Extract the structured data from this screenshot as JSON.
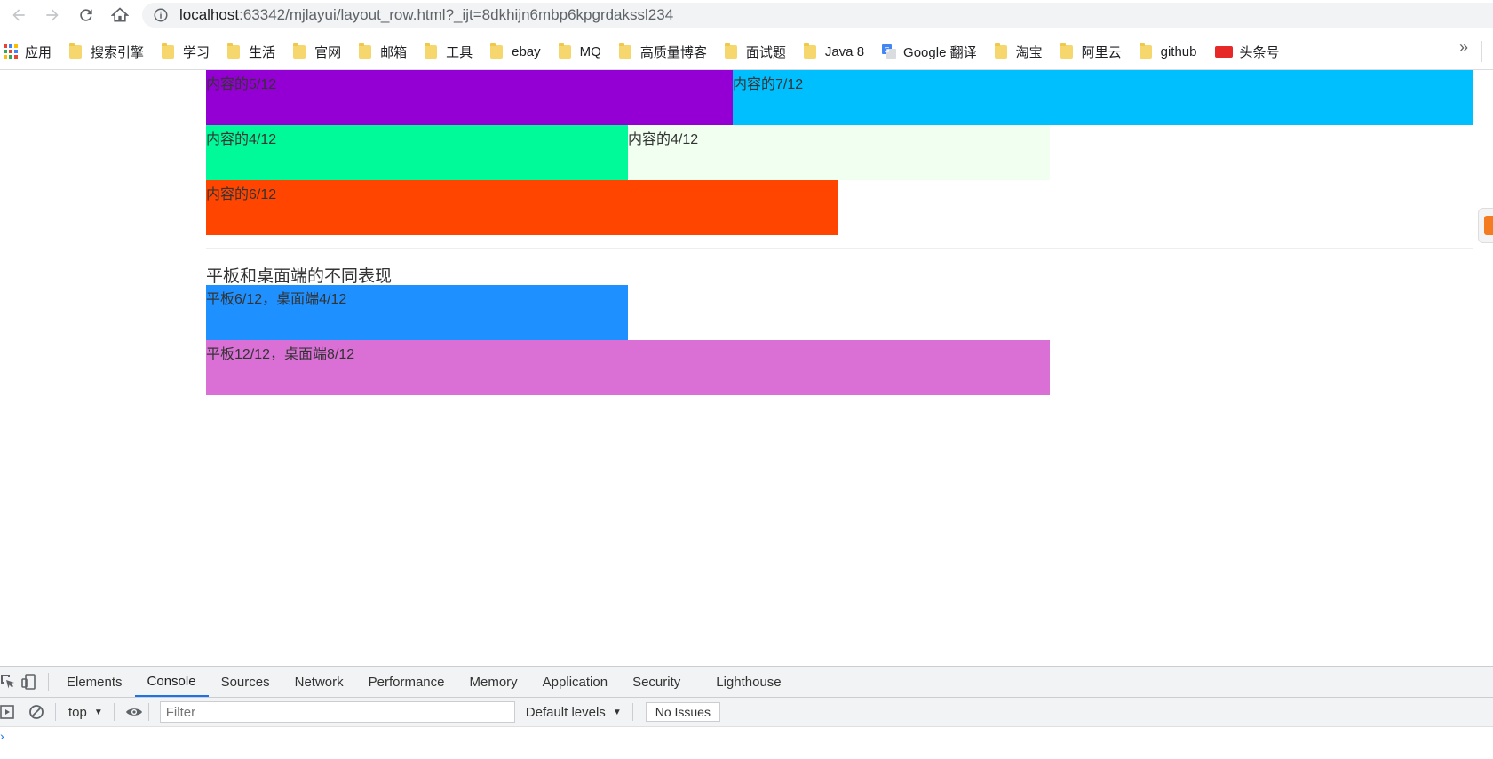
{
  "browser": {
    "url_host": "localhost",
    "url_path": ":63342/mjlayui/layout_row.html?_ijt=8dkhijn6mbp6kpgrdakssl234"
  },
  "bookmarks": {
    "apps_label": "应用",
    "items": [
      {
        "label": "搜索引擎"
      },
      {
        "label": "学习"
      },
      {
        "label": "生活"
      },
      {
        "label": "官网"
      },
      {
        "label": "邮箱"
      },
      {
        "label": "工具"
      },
      {
        "label": "ebay"
      },
      {
        "label": "MQ"
      },
      {
        "label": "高质量博客"
      },
      {
        "label": "面试题"
      },
      {
        "label": "Java 8"
      }
    ],
    "translate_label": "Google 翻译",
    "items2": [
      {
        "label": "淘宝"
      },
      {
        "label": "阿里云"
      },
      {
        "label": "github"
      }
    ],
    "toutiao_label": "头条号",
    "more": "»"
  },
  "page": {
    "rows": [
      [
        {
          "label": "内容的5/12",
          "color": "#9400d3"
        },
        {
          "label": "内容的7/12",
          "color": "#00bfff"
        }
      ],
      [
        {
          "label": "内容的4/12",
          "color": "#00fa9a"
        },
        {
          "label": "内容的4/12",
          "color": "#f0fff0"
        }
      ],
      [
        {
          "label": "内容的6/12",
          "color": "#ff4500"
        }
      ]
    ],
    "section_title": "平板和桌面端的不同表现",
    "responsive_rows": [
      {
        "label": "平板6/12，桌面端4/12",
        "color": "#1e90ff"
      },
      {
        "label": "平板12/12，桌面端8/12",
        "color": "#da70d6"
      }
    ]
  },
  "devtools": {
    "tabs": [
      {
        "label": "Elements"
      },
      {
        "label": "Console"
      },
      {
        "label": "Sources"
      },
      {
        "label": "Network"
      },
      {
        "label": "Performance"
      },
      {
        "label": "Memory"
      },
      {
        "label": "Application"
      },
      {
        "label": "Security"
      },
      {
        "label": "Lighthouse"
      }
    ],
    "active_tab": "Console",
    "context": "top",
    "filter_placeholder": "Filter",
    "levels": "Default levels",
    "issues": "No Issues",
    "caret": "›"
  }
}
